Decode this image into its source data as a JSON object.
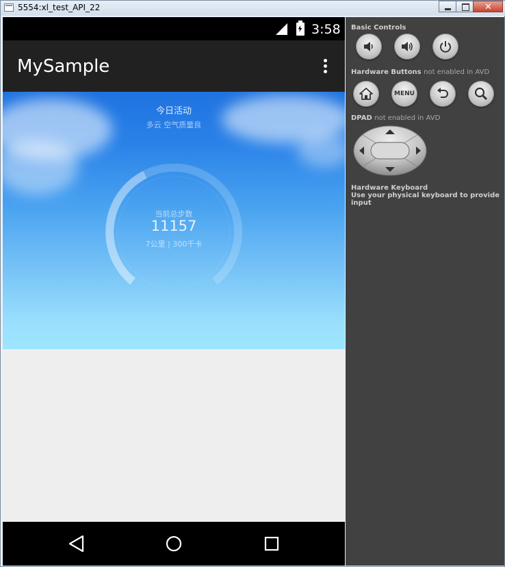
{
  "window": {
    "title": "5554:xl_test_API_22"
  },
  "status_bar": {
    "time": "3:58",
    "icons": [
      "signal-icon",
      "battery-charging-icon"
    ]
  },
  "app_bar": {
    "title": "MySample",
    "overflow_icon": "more-vert-icon"
  },
  "activity": {
    "title": "今日活动",
    "weather": "多云 空气质量良",
    "steps_label": "当前总步数",
    "steps_value": "11157",
    "detail": "7公里 | 300千卡"
  },
  "nav_bar": {
    "icons": [
      "back-icon",
      "home-icon",
      "recents-icon"
    ]
  },
  "controls_panel": {
    "basic_controls_label": "Basic Controls",
    "basic_controls": [
      "volume-down-icon",
      "volume-up-icon",
      "power-icon"
    ],
    "hardware_buttons_label": "Hardware Buttons",
    "hardware_buttons_note": "not enabled in AVD",
    "hardware_buttons": [
      "home-icon",
      "menu-button",
      "back-icon",
      "search-icon"
    ],
    "menu_label": "MENU",
    "dpad_label": "DPAD",
    "dpad_note": "not enabled in AVD",
    "keyboard_label": "Hardware Keyboard",
    "keyboard_desc": "Use your physical keyboard to provide input"
  },
  "colors": {
    "status_bar": "#000000",
    "app_bar": "#212121",
    "sky_top": "#1f73e0",
    "sky_bottom": "#9ee6ff",
    "content_bg": "#eeeeee",
    "panel_bg": "#414141"
  }
}
